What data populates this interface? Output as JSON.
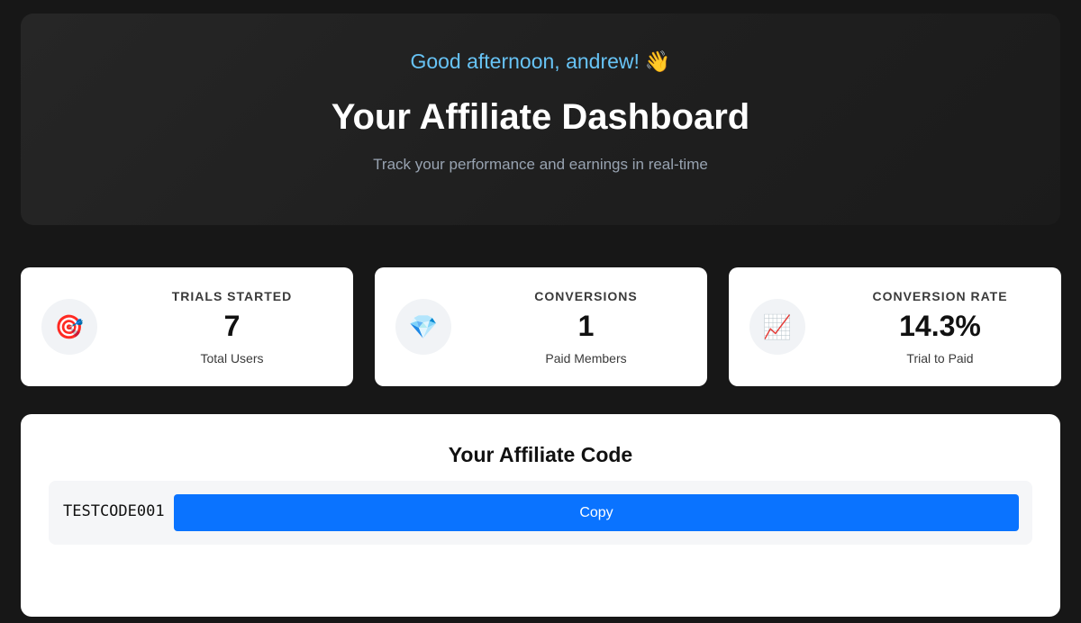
{
  "hero": {
    "greeting": "Good afternoon, andrew!",
    "greeting_emoji": "👋",
    "title": "Your Affiliate Dashboard",
    "subtitle": "Track your performance and earnings in real-time"
  },
  "stats": [
    {
      "icon": "target-icon",
      "glyph": "🎯",
      "label": "TRIALS STARTED",
      "value": "7",
      "caption": "Total Users"
    },
    {
      "icon": "gem-icon",
      "glyph": "💎",
      "label": "CONVERSIONS",
      "value": "1",
      "caption": "Paid Members"
    },
    {
      "icon": "chart-increasing-icon",
      "glyph": "📈",
      "label": "CONVERSION RATE",
      "value": "14.3%",
      "caption": "Trial to Paid"
    }
  ],
  "affiliate": {
    "title": "Your Affiliate Code",
    "code": "TESTCODE001",
    "copy_label": "Copy"
  },
  "colors": {
    "background": "#171717",
    "greeting": "#67c3f5",
    "accent": "#0a73ff"
  }
}
